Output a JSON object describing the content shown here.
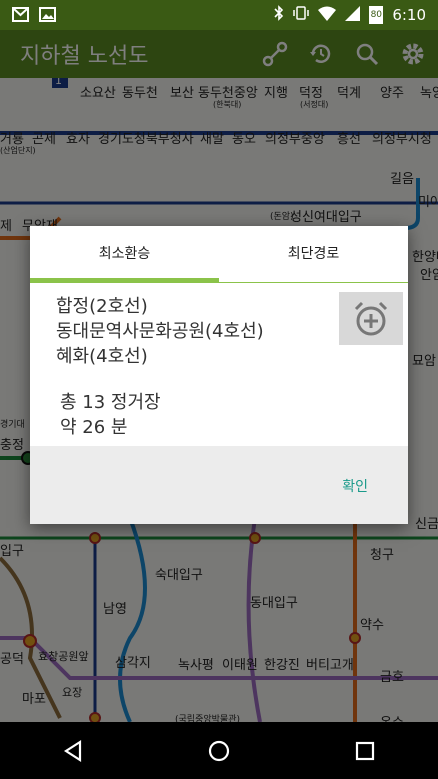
{
  "status_bar": {
    "time": "6:10",
    "battery": "80"
  },
  "app_bar": {
    "title": "지하철 노선도",
    "actions": [
      "route-icon",
      "history-icon",
      "search-icon",
      "gear-icon"
    ]
  },
  "map": {
    "line_badge": "1",
    "stations": [
      "소요산",
      "동두천",
      "보산",
      "동두천중앙",
      "(한북대)",
      "지행",
      "덕정",
      "(서정대)",
      "덕계",
      "양주",
      "녹양",
      "거룡",
      "곤제",
      "효자",
      "경기도청북부청사",
      "새말",
      "동오",
      "의정부중앙",
      "흥선",
      "의정부시청",
      "길음",
      "미아",
      "(산업단지)",
      "(돈암)",
      "성신여대입구",
      "제",
      "무악재",
      "한양대",
      "안암",
      "묘암",
      "충정",
      "경기대",
      "신금호",
      "청구",
      "입구",
      "숙대입구",
      "남영",
      "동대입구",
      "약수",
      "공덕",
      "효창공원앞",
      "삼각지",
      "녹사평",
      "이태원",
      "한강진",
      "버티고개",
      "금호",
      "마포",
      "요장",
      "(국립중앙박물관)",
      "옥수"
    ]
  },
  "dialog": {
    "tabs": [
      "최소환승",
      "최단경로"
    ],
    "selected_tab": "최소환승",
    "route": [
      "합정(2호선)",
      "동대문역사문화공원(4호선)",
      "혜화(4호선)"
    ],
    "summary": {
      "stops": "총  13 정거장",
      "time": "약 26 분"
    },
    "alarm_icon": "alarm-add-icon",
    "ok_label": "확인"
  },
  "nav_bar": {
    "icons": [
      "back-icon",
      "home-icon",
      "recents-icon"
    ]
  },
  "colors": {
    "app_bar": "#5b8a23",
    "status_bar": "#3a5a14",
    "accent": "#8bc34a",
    "ok": "#1a9a8a"
  }
}
